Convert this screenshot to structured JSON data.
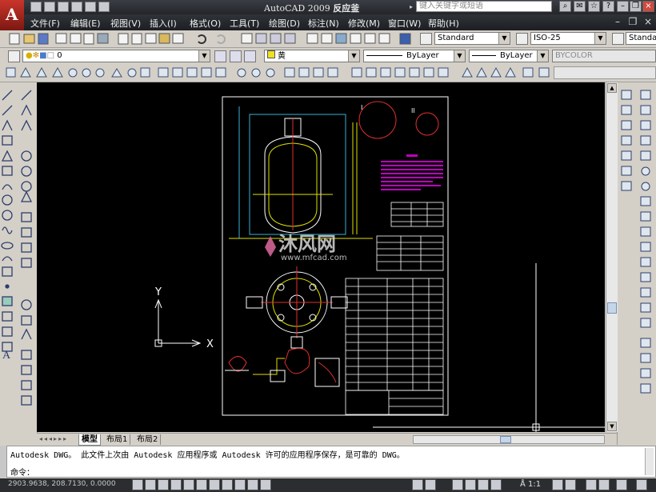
{
  "app": {
    "logo_letter": "A",
    "title_prefix": "AutoCAD 2009",
    "title_file": "反应釜"
  },
  "search": {
    "placeholder": "键入关键字或短语"
  },
  "menu": [
    "文件(F)",
    "编辑(E)",
    "视图(V)",
    "插入(I)",
    "格式(O)",
    "工具(T)",
    "绘图(D)",
    "标注(N)",
    "修改(M)",
    "窗口(W)",
    "帮助(H)"
  ],
  "styles_toolbar": {
    "text_style": "Standard",
    "dim_style": "ISO-25",
    "table_style": "Standard"
  },
  "layers_toolbar": {
    "layer": "0"
  },
  "properties_toolbar": {
    "color": "黄",
    "linetype": "ByLayer",
    "lineweight": "ByLayer",
    "plotstyle": "BYCOLOR"
  },
  "ucs": {
    "y_label": "Y",
    "x_label": "X"
  },
  "drawing": {
    "watermark_cn": "沐风网",
    "watermark_url": "www.mfcad.com",
    "detail_labels": [
      "I",
      "II"
    ]
  },
  "layout_tabs": [
    "模型",
    "布局1",
    "布局2"
  ],
  "command": {
    "message": "Autodesk DWG。  此文件上次由 Autodesk 应用程序或 Autodesk 许可的应用程序保存，是可靠的 DWG。",
    "prompt": "命令："
  },
  "status": {
    "coords": "2903.9638, 208.7130, 0.0000",
    "annotation_scale": "1:1"
  },
  "colors": {
    "accent": "#c9352b",
    "canvas": "#000000",
    "drawing_border": "#ffffff",
    "drawing_yellow": "#f0e020",
    "drawing_magenta": "#c000c0",
    "drawing_red": "#e03030"
  }
}
